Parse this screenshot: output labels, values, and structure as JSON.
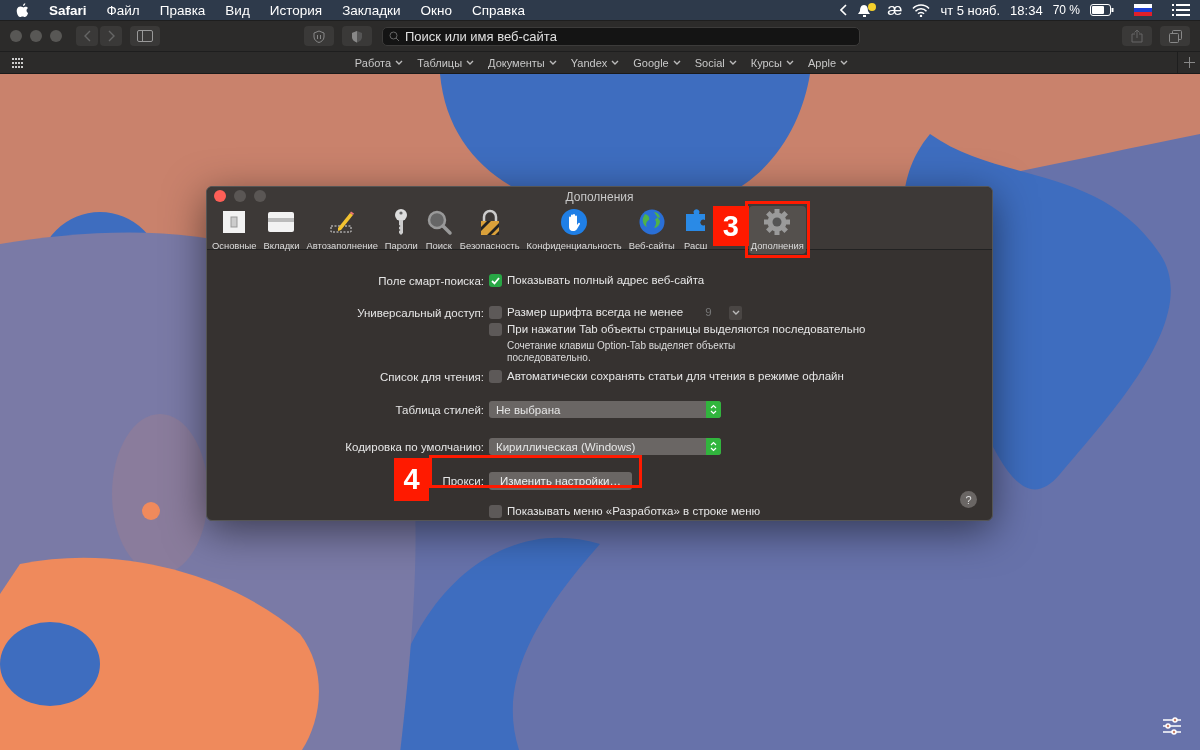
{
  "menubar": {
    "app_name": "Safari",
    "menus": [
      "Файл",
      "Правка",
      "Вид",
      "История",
      "Закладки",
      "Окно",
      "Справка"
    ],
    "input_mark": "æ",
    "date": "чт 5 нояб.",
    "time": "18:34",
    "battery_text": "70 %"
  },
  "browser_toolbar": {
    "search": {
      "placeholder": "Поиск или имя веб-сайта"
    }
  },
  "bookmarks": [
    "Работа",
    "Таблицы",
    "Документы",
    "Yandex",
    "Google",
    "Social",
    "Курсы",
    "Apple"
  ],
  "preferences": {
    "title": "Дополнения",
    "tabs": [
      {
        "label": "Основные",
        "kind": "switch",
        "selected": false
      },
      {
        "label": "Вкладки",
        "kind": "tabs",
        "selected": false
      },
      {
        "label": "Автозаполнение",
        "kind": "pencil",
        "selected": false
      },
      {
        "label": "Пароли",
        "kind": "key",
        "selected": false
      },
      {
        "label": "Поиск",
        "kind": "magnifier",
        "selected": false
      },
      {
        "label": "Безопасность",
        "kind": "lock",
        "selected": false
      },
      {
        "label": "Конфиденциальность",
        "kind": "hand",
        "selected": false
      },
      {
        "label": "Веб-сайты",
        "kind": "globe",
        "selected": false
      },
      {
        "label": "Расш",
        "kind": "puzzle",
        "selected": false
      },
      {
        "label": "Дополнения",
        "kind": "gear",
        "selected": true
      }
    ],
    "rows": [
      {
        "kind": "checkboxes",
        "label": "Поле смарт-поиска:",
        "options": [
          {
            "text": "Показывать полный адрес веб-сайта",
            "checked": true
          }
        ]
      },
      {
        "kind": "checkboxes",
        "label": "Универсальный доступ:",
        "options": [
          {
            "text": "Размер шрифта всегда не менее",
            "checked": false,
            "popup": {
              "value": "9",
              "disabled": true
            }
          },
          {
            "text": "При нажатии Tab объекты страницы выделяются последовательно",
            "checked": false,
            "note": "Сочетание клавиш Option-Tab выделяет объекты последовательно."
          }
        ]
      },
      {
        "kind": "checkboxes",
        "label": "Список для чтения:",
        "options": [
          {
            "text": "Автоматически сохранять статьи для чтения в режиме офлайн",
            "checked": false
          }
        ]
      },
      {
        "kind": "popup",
        "label": "Таблица стилей:",
        "value": "Не выбрана"
      },
      {
        "kind": "popup",
        "label": "Кодировка по умолчанию:",
        "value": "Кириллическая (Windows)"
      },
      {
        "kind": "button",
        "label": "Прокси:",
        "button": "Изменить настройки…"
      },
      {
        "kind": "checkboxes",
        "options": [
          {
            "text": "Показывать меню «Разработка» в строке меню",
            "checked": false
          }
        ]
      }
    ],
    "help": "?"
  },
  "annotations": [
    {
      "number": "3"
    },
    {
      "number": "4"
    }
  ]
}
